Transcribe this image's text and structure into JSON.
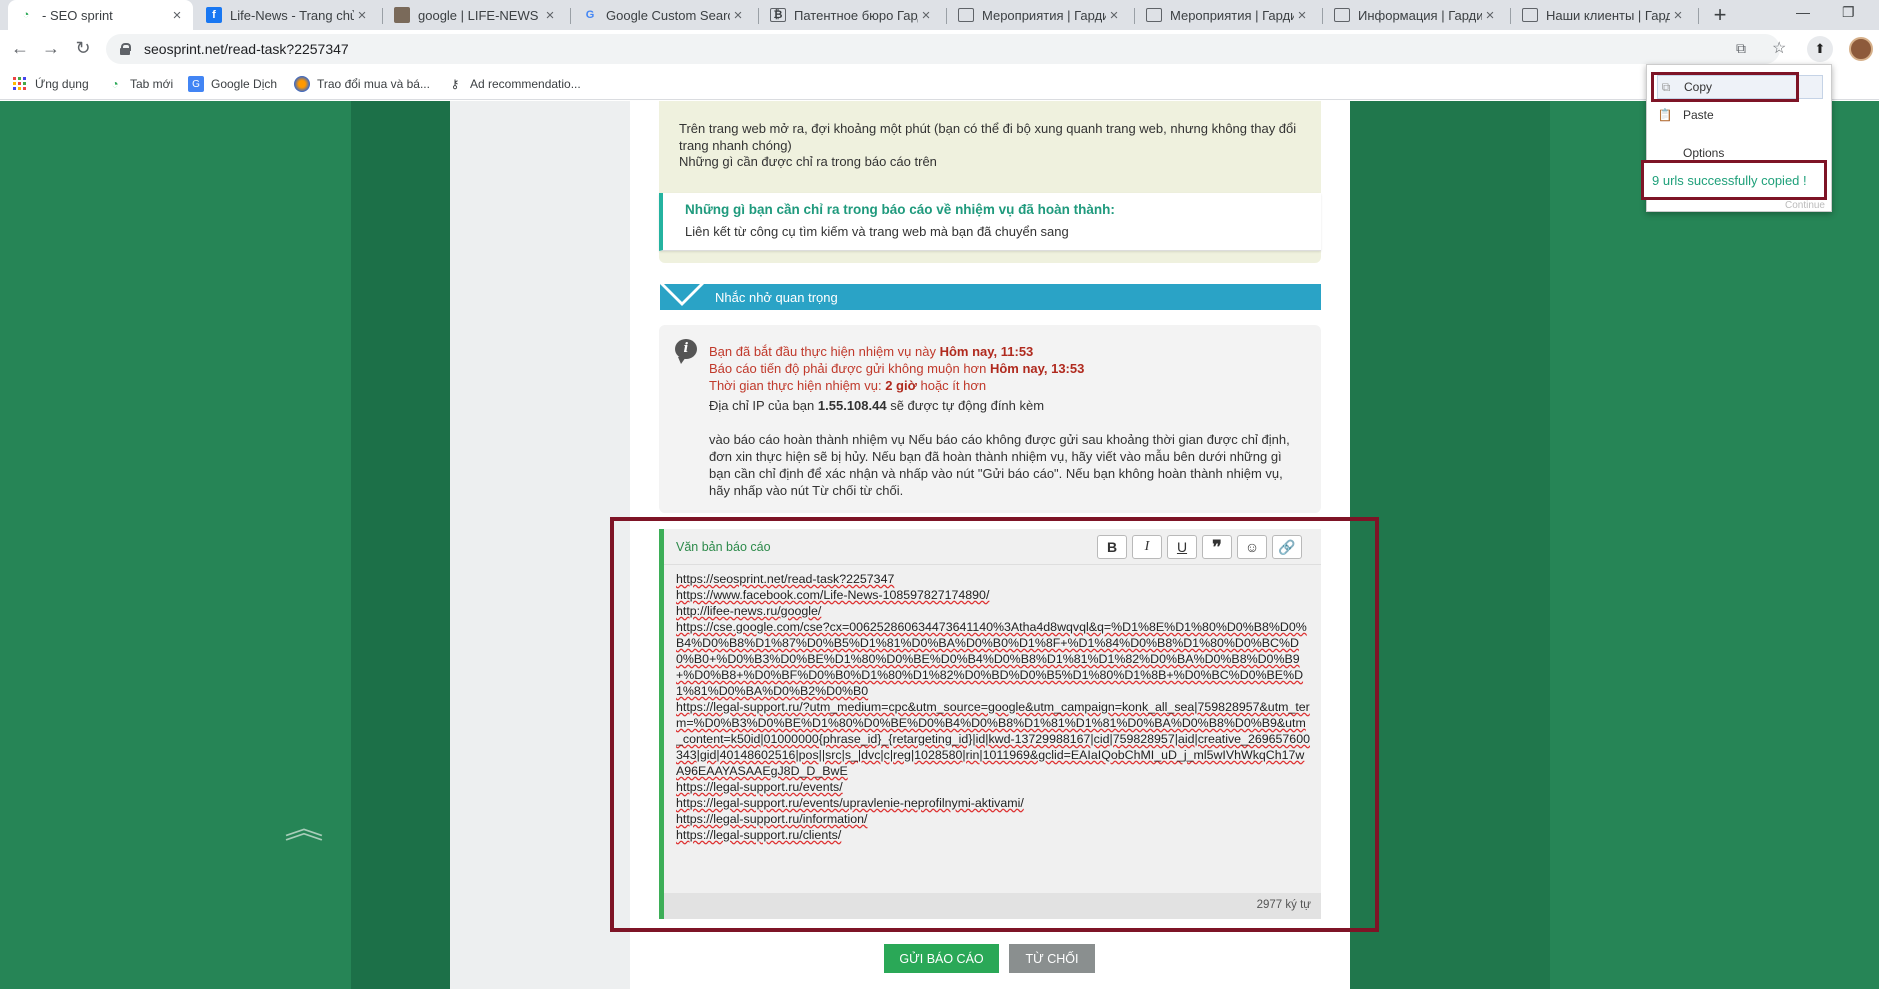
{
  "tabs": [
    {
      "title": "- SEO sprint",
      "icon": "seosprint-icon"
    },
    {
      "title": "Life-News - Trang chủ |",
      "icon": "facebook-icon"
    },
    {
      "title": "google | LIFE-NEWS",
      "icon": "image-icon"
    },
    {
      "title": "Google Custom Search",
      "icon": "google-icon"
    },
    {
      "title": "Патентное бюро Гарди",
      "icon": "site-icon"
    },
    {
      "title": "Мероприятия | Гардиу",
      "icon": "site-icon"
    },
    {
      "title": "Мероприятия | Гардиу",
      "icon": "site-icon"
    },
    {
      "title": "Информация | Гардиу",
      "icon": "site-icon"
    },
    {
      "title": "Наши клиенты | Гард",
      "icon": "site-icon"
    }
  ],
  "address": {
    "url": "seosprint.net/read-task?2257347"
  },
  "bookmarks": [
    {
      "label": "Ứng dụng",
      "icon": "apps-grid-icon"
    },
    {
      "label": "Tab mới",
      "icon": "seosprint-icon"
    },
    {
      "label": "Google Dịch",
      "icon": "translate-icon"
    },
    {
      "label": "Trao đổi mua và bá...",
      "icon": "exchange-icon"
    },
    {
      "label": "Ad recommendatio...",
      "icon": "key-icon"
    }
  ],
  "description": {
    "truncated_top": "(... ... ... ... ...)",
    "paragraph": "Trên trang web mở ra, đợi khoảng một phút (bạn có thể đi bộ xung quanh trang web, nhưng không thay đổi trang nhanh chóng)",
    "paragraph2": "Những gì cần được chỉ ra trong báo cáo trên",
    "note_heading": "Những gì bạn cần chỉ ra trong báo cáo về nhiệm vụ đã hoàn thành:",
    "note_body": "Liên kết từ công cụ tìm kiếm và trang web mà bạn đã chuyển sang"
  },
  "reminder": {
    "title": "Nhắc nhở quan trọng"
  },
  "info": {
    "started_prefix": "Bạn đã bắt đầu thực hiện nhiệm vụ này",
    "started_value": "Hôm nay, 11:53",
    "deadline_prefix": "Báo cáo tiến độ phải được gửi không muộn hơn",
    "deadline_value": "Hôm nay, 13:53",
    "duration_prefix": "Thời gian thực hiện nhiệm vụ:",
    "duration_value": "2 giờ",
    "duration_suffix": "hoặc ít hơn",
    "ip_prefix": "Địa chỉ IP của bạn",
    "ip_value": "1.55.108.44",
    "ip_suffix": "sẽ được tự động đính kèm",
    "body": "vào báo cáo hoàn thành nhiệm vụ Nếu báo cáo không được gửi sau khoảng thời gian được chỉ định, đơn xin thực hiện sẽ bị hủy. Nếu bạn đã hoàn thành nhiệm vụ, hãy viết vào mẫu bên dưới những gì bạn cần chỉ định để xác nhận và nhấp vào nút \"Gửi báo cáo\". Nếu bạn không hoàn thành nhiệm vụ, hãy nhấp vào nút Từ chối từ chối."
  },
  "report": {
    "title": "Văn bản báo cáo",
    "lines": [
      "https://seosprint.net/read-task?2257347",
      "https://www.facebook.com/Life-News-108597827174890/",
      "http://lifee-news.ru/google/",
      "https://cse.google.com/cse?cx=006252860634473641140%3Atha4d8wqvql&q=%D1%8E%D1%80%D0%B8%D0%B4%D0%B8%D1%87%D0%B5%D1%81%D0%BA%D0%B0%D1%8F+%D1%84%D0%B8%D1%80%D0%BC%D0%B0+%D0%B3%D0%BE%D1%80%D0%BE%D0%B4%D0%B8%D1%81%D1%82%D0%BA%D0%B8%D0%B9+%D0%B8+%D0%BF%D0%B0%D1%80%D1%82%D0%BD%D0%B5%D1%80%D1%8B+%D0%BC%D0%BE%D1%81%D0%BA%D0%B2%D0%B0",
      "https://legal-support.ru/?utm_medium=cpc&utm_source=google&utm_campaign=konk_all_sea|759828957&utm_term=%D0%B3%D0%BE%D1%80%D0%BE%D0%B4%D0%B8%D1%81%D1%81%D0%BA%D0%B8%D0%B9&utm_content=k50id|01000000{phrase_id}_{retargeting_id}|id|kwd-13729988167|cid|759828957|aid|creative_269657600343|gid|40148602516|pos||src|s_|dvc|c|reg|1028580|rin|1011969&gclid=EAIaIQobChMI_uD_j_ml5wIVhWkqCh17wA96EAAYASAAEgJ8D_D_BwE",
      "https://legal-support.ru/events/",
      "https://legal-support.ru/events/upravlenie-neprofilnymi-aktivami/",
      "https://legal-support.ru/information/",
      "https://legal-support.ru/clients/"
    ],
    "char_count": "2977 ký tự"
  },
  "buttons": {
    "send": "GỬI BÁO CÁO",
    "reject": "TỪ CHỐI"
  },
  "popup": {
    "copy": "Copy",
    "paste": "Paste",
    "options": "Options",
    "status": "9 urls successfully copied !",
    "continue": "Continue"
  },
  "colors": {
    "accent_green": "#2aa857",
    "highlight_frame": "#7e1426",
    "reminder_bar": "#2aa3c6"
  }
}
